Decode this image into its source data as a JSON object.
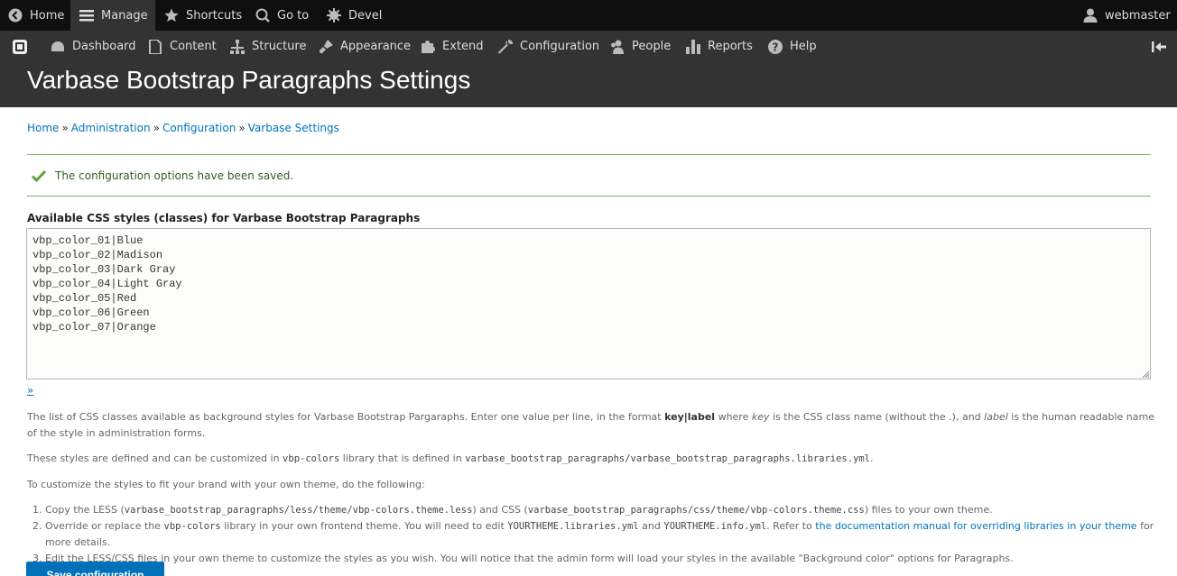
{
  "topbar": {
    "home": "Home",
    "manage": "Manage",
    "shortcuts": "Shortcuts",
    "goto": "Go to",
    "devel": "Devel",
    "user": "webmaster"
  },
  "tray": {
    "items": [
      "Dashboard",
      "Content",
      "Structure",
      "Appearance",
      "Extend",
      "Configuration",
      "People",
      "Reports",
      "Help"
    ]
  },
  "page": {
    "title": "Varbase Bootstrap Paragraphs Settings"
  },
  "breadcrumb": [
    "Home",
    "Administration",
    "Configuration",
    "Varbase Settings"
  ],
  "status_message": "The configuration options have been saved.",
  "field": {
    "label": "Available CSS styles (classes) for Varbase Bootstrap Paragraphs",
    "value": "vbp_color_01|Blue\nvbp_color_02|Madison\nvbp_color_03|Dark Gray\nvbp_color_04|Light Gray\nvbp_color_05|Red\nvbp_color_06|Green\nvbp_color_07|Orange",
    "toggle": "»"
  },
  "description": {
    "p1_a": "The list of CSS classes available as background styles for Varbase Bootstrap Pargaraphs. Enter one value per line, in the format ",
    "p1_key_label": "key|label",
    "p1_b": " where ",
    "p1_key": "key",
    "p1_c": " is the CSS class name (without the .), and ",
    "p1_label": "label",
    "p1_d": " is the human readable name of the style in administration forms.",
    "p2_a": "These styles are defined and can be customized in ",
    "p2_lib": "vbp-colors",
    "p2_b": " library that is defined in ",
    "p2_file": "varbase_bootstrap_paragraphs/varbase_bootstrap_paragraphs.libraries.yml",
    "p2_c": ".",
    "p3": "To customize the styles to fit your brand with your own theme, do the following:",
    "li1_a": "Copy the LESS (",
    "li1_less": "varbase_bootstrap_paragraphs/less/theme/vbp-colors.theme.less",
    "li1_b": ") and CSS (",
    "li1_css": "varbase_bootstrap_paragraphs/css/theme/vbp-colors.theme.css",
    "li1_c": ") files to your own theme.",
    "li2_a": "Override or replace the ",
    "li2_lib": "vbp-colors",
    "li2_b": " library in your own frontend theme. You will need to edit ",
    "li2_file1": "YOURTHEME.libraries.yml",
    "li2_c": " and ",
    "li2_file2": "YOURTHEME.info.yml",
    "li2_d": ". Refer to ",
    "li2_link": "the documentation manual for overriding libraries in your theme",
    "li2_e": " for more details.",
    "li3": "Edit the LESS/CSS files in your own theme to customize the styles as you wish. You will notice that the admin form will load your styles in the available \"Background color\" options for Paragraphs."
  },
  "actions": {
    "save": "Save configuration"
  },
  "colors": {
    "toolbar_bg": "#0f0f0f",
    "tray_bg": "#333333",
    "link": "#0074bd",
    "success": "#77b259",
    "button": "#0071b8"
  }
}
